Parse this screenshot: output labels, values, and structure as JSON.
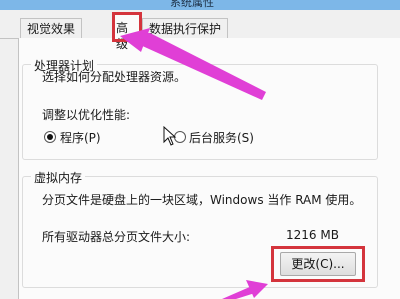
{
  "window": {
    "title": "系统属性"
  },
  "tabs": [
    {
      "label": "视觉效果",
      "active": false
    },
    {
      "label": "高级",
      "active": true
    },
    {
      "label": "数据执行保护",
      "active": false
    }
  ],
  "processor_group": {
    "title": "处理器计划",
    "description": "选择如何分配处理器资源。",
    "optimize_label": "调整以优化性能:",
    "options": [
      {
        "label": "程序(P)",
        "checked": true
      },
      {
        "label": "后台服务(S)",
        "checked": false
      }
    ]
  },
  "memory_group": {
    "title": "虚拟内存",
    "description": "分页文件是硬盘上的一块区域，Windows 当作 RAM 使用。",
    "total_label": "所有驱动器总分页文件大小:",
    "total_value": "1216 MB",
    "change_button": "更改(C)..."
  },
  "colors": {
    "highlight": "#d4343c",
    "arrow": "#e03fd6",
    "accent": "#7db7e8"
  },
  "icons": [
    "mouse-pointer-icon",
    "annotation-arrow"
  ]
}
